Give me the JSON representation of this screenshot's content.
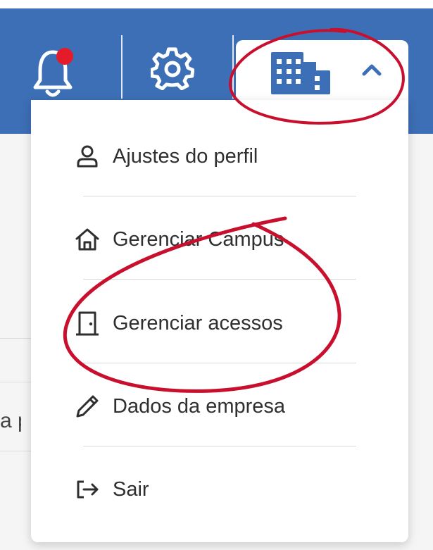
{
  "header": {
    "icons": {
      "notifications": "bell-icon",
      "settings": "gear-icon",
      "organization": "building-icon",
      "collapse": "chevron-up-icon"
    },
    "has_unread_notification": true
  },
  "background_text": "a p",
  "profile_menu": {
    "items": [
      {
        "label": "Ajustes do perfil",
        "icon": "user-icon"
      },
      {
        "label": "Gerenciar Campus",
        "icon": "home-icon"
      },
      {
        "label": "Gerenciar acessos",
        "icon": "door-icon"
      },
      {
        "label": "Dados da empresa",
        "icon": "pencil-icon"
      },
      {
        "label": "Sair",
        "icon": "logout-icon"
      }
    ]
  },
  "colors": {
    "header_bg": "#3d6fb6",
    "notification_dot": "#e41b2a",
    "annotation_ink": "#c8102e",
    "menu_text": "#2f2f2f"
  }
}
